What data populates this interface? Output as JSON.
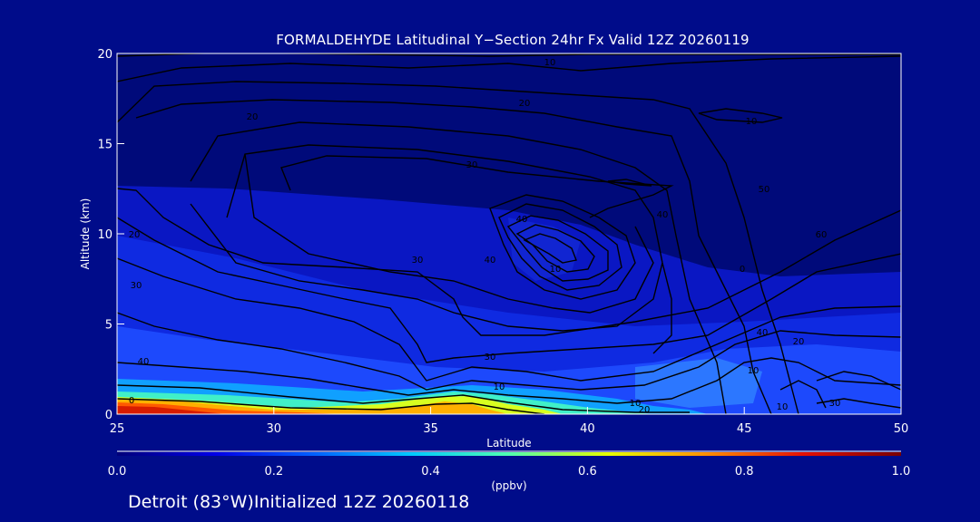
{
  "chart_data": {
    "type": "heatmap",
    "title": "FORMALDEHYDE Latitudinal Y−Section 24hr  Fx Valid 12Z 20260119",
    "xlabel": "Latitude",
    "ylabel": "Altitude (km)",
    "xlim": [
      25,
      50
    ],
    "ylim": [
      0,
      20
    ],
    "x_ticks": [
      "25",
      "30",
      "35",
      "40",
      "45",
      "50"
    ],
    "y_ticks": [
      "0",
      "5",
      "10",
      "15",
      "20"
    ],
    "colorbar": {
      "label": "(ppbv)",
      "range": [
        0.0,
        1.0
      ],
      "ticks": [
        "0.0",
        "0.2",
        "0.4",
        "0.6",
        "0.8",
        "1.0"
      ],
      "colors": [
        "#00007a",
        "#0000e6",
        "#0060ff",
        "#00c8ff",
        "#50ffb0",
        "#e6ff00",
        "#ff9000",
        "#e61000",
        "#780000"
      ]
    },
    "contour_labels": [
      "10",
      "20",
      "20",
      "30",
      "30",
      "40",
      "40",
      "40",
      "50",
      "60",
      "10",
      "20",
      "30",
      "30",
      "40",
      "10",
      "10",
      "20",
      "30",
      "40",
      "0",
      "10",
      "20",
      "0",
      "10",
      "10"
    ],
    "grid": false
  },
  "footer": {
    "location": "Detroit (83°W)Initialized 12Z 20260118"
  }
}
